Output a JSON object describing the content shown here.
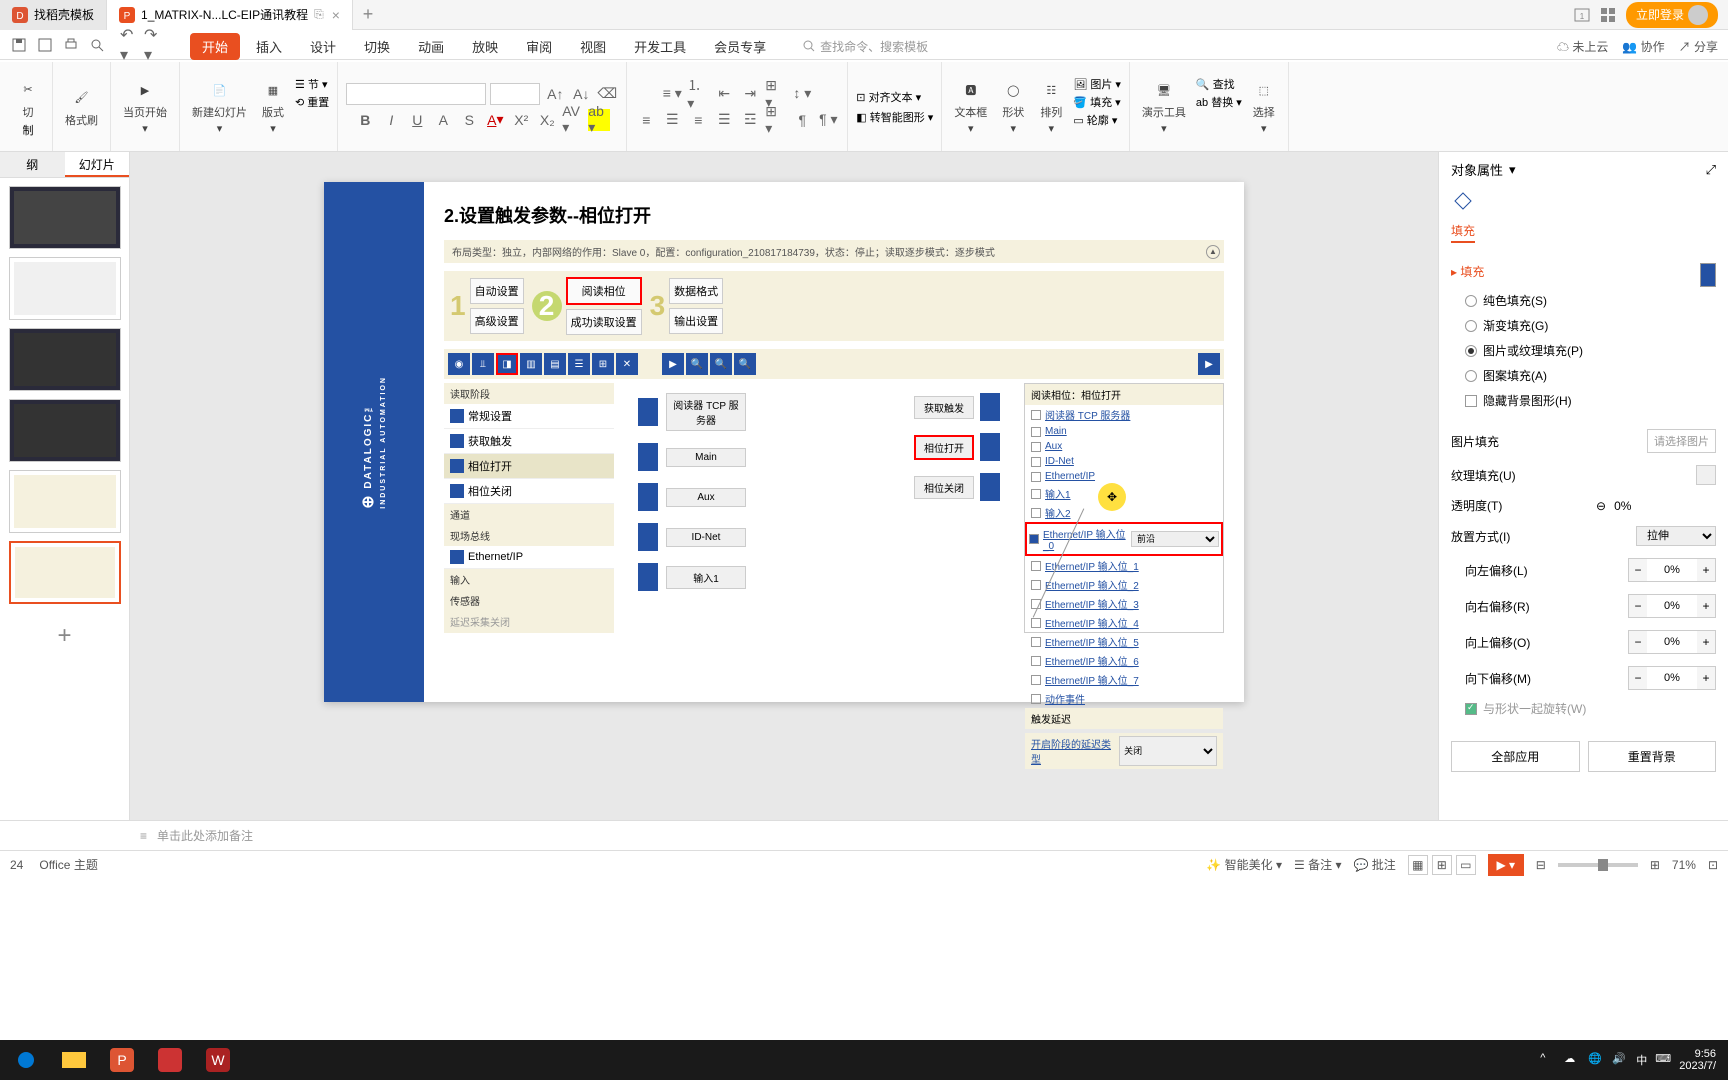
{
  "titlebar": {
    "shell_tab": "找稻壳模板",
    "doc_tab": "1_MATRIX-N...LC-EIP通讯教程",
    "login": "立即登录"
  },
  "ribbon_tabs": [
    "开始",
    "插入",
    "设计",
    "切换",
    "动画",
    "放映",
    "审阅",
    "视图",
    "开发工具",
    "会员专享"
  ],
  "search_placeholder": "查找命令、搜索模板",
  "cloud": "未上云",
  "collab": "协作",
  "share": "分享",
  "ribbon": {
    "cut": "切",
    "copy": "制",
    "format_painter": "格式刷",
    "paste": "当页开始",
    "new_slide": "新建幻灯片",
    "layout": "版式",
    "section": "节",
    "reset": "重置",
    "textbox": "文本框",
    "shapes": "形状",
    "arrange": "排列",
    "picture": "图片",
    "fill": "填充",
    "outline": "轮廓",
    "find": "查找",
    "present": "演示工具",
    "replace": "替换",
    "select": "选择",
    "align_text": "对齐文本",
    "smart_graphic": "转智能图形"
  },
  "outline": {
    "tab1": "纲",
    "tab2": "幻灯片",
    "add": "+"
  },
  "slide": {
    "logo": "DATALOGIC",
    "logo_sub": "INDUSTRIAL AUTOMATION",
    "title": "2.设置触发参数--相位打开",
    "config_bar": "布局类型：独立，内部网络的作用：Slave 0，配置：configuration_210817184739，状态：停止；读取逐步模式：逐步模式",
    "step1a": "自动设置",
    "step1b": "高级设置",
    "step2a": "阅读相位",
    "step2b": "成功读取设置",
    "step3a": "数据格式",
    "step3b": "输出设置",
    "left_panel": {
      "section1": "读取阶段",
      "items1": [
        "常规设置",
        "获取触发",
        "相位打开",
        "相位关闭"
      ],
      "section2": "通道",
      "section3": "现场总线",
      "items3": [
        "Ethernet/IP"
      ],
      "section4_items": [
        "输入",
        "传感器"
      ],
      "section5": "延迟采集关闭"
    },
    "mid": {
      "items": [
        "阅读器 TCP 服务器",
        "Main",
        "Aux",
        "ID-Net",
        "输入1"
      ],
      "right_items": [
        "获取触发",
        "相位打开",
        "相位关闭"
      ]
    },
    "right_panel": {
      "header": "阅读相位：相位打开",
      "items": [
        "阅读器 TCP 服务器",
        "Main",
        "Aux",
        "ID-Net",
        "Ethernet/IP",
        "输入1",
        "输入2"
      ],
      "eip_items": [
        "Ethernet/IP 输入位_0",
        "Ethernet/IP 输入位_1",
        "Ethernet/IP 输入位_2",
        "Ethernet/IP 输入位_3",
        "Ethernet/IP 输入位_4",
        "Ethernet/IP 输入位_5",
        "Ethernet/IP 输入位_6",
        "Ethernet/IP 输入位_7"
      ],
      "eip_select": "前沿",
      "action_event": "动作事件",
      "trigger_delay": "触发延迟",
      "footer_label": "开启阶段的延迟类型",
      "footer_select": "关闭"
    }
  },
  "props": {
    "title": "对象属性",
    "tab": "填充",
    "section": "填充",
    "solid": "纯色填充(S)",
    "gradient": "渐变填充(G)",
    "picture": "图片或纹理填充(P)",
    "pattern": "图案填充(A)",
    "hide_bg": "隐藏背景图形(H)",
    "pic_fill": "图片填充",
    "pic_select": "请选择图片",
    "texture": "纹理填充(U)",
    "transparency": "透明度(T)",
    "transparency_val": "0%",
    "placement": "放置方式(I)",
    "placement_val": "拉伸",
    "offset_left": "向左偏移(L)",
    "offset_right": "向右偏移(R)",
    "offset_up": "向上偏移(O)",
    "offset_down": "向下偏移(M)",
    "offset_val": "0%",
    "rotate": "与形状一起旋转(W)",
    "apply_all": "全部应用",
    "reset_bg": "重置背景"
  },
  "notes": "单击此处添加备注",
  "statusbar": {
    "slide_num": "24",
    "theme": "Office 主题",
    "smart": "智能美化",
    "backup": "备注",
    "review": "批注",
    "zoom": "71%"
  },
  "taskbar": {
    "time": "9:56",
    "date": "2023/7/",
    "ime": "中"
  }
}
